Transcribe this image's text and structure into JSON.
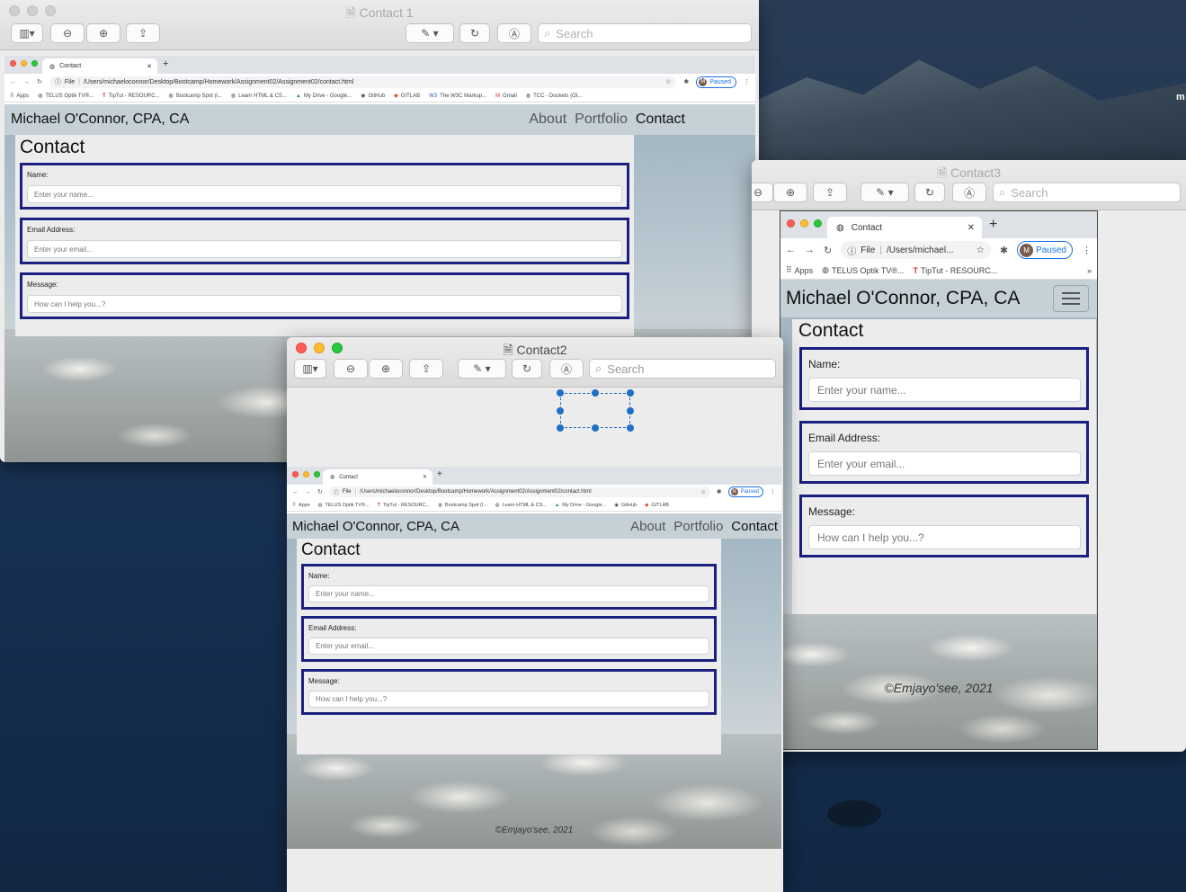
{
  "site": {
    "brand": "Michael O'Connor, CPA, CA",
    "nav": [
      "About",
      "Portfolio",
      "Contact"
    ],
    "heading": "Contact",
    "name_label": "Name:",
    "name_placeholder": "Enter your name...",
    "email_label": "Email Address:",
    "email_placeholder": "Enter your email...",
    "message_label": "Message:",
    "message_placeholder": "How can I help you...?",
    "footer": "©Emjayo'see, 2021"
  },
  "browser": {
    "tab_title": "Contact",
    "new_tab": "+",
    "file_label": "File",
    "url": "/Users/michaeloconnor/Desktop/Bootcamp/Homework/Assignment02/Assignment02/contact.html",
    "url_short": "/Users/michael...",
    "paused": "Paused",
    "avatar": "M",
    "bookmarks": [
      "Apps",
      "TELUS Optik TV®...",
      "TipTut - RESOURC...",
      "Bootcamp Spot (l...",
      "Learn HTML & CS...",
      "My Drive - Google...",
      "GitHub",
      "GITLAB",
      "The W3C Markup...",
      "Gmail",
      "TCC - Dockets (Ol..."
    ]
  },
  "windows": {
    "contact1": {
      "title": "Contact 1"
    },
    "contact2": {
      "title": "Contact2"
    },
    "contact3": {
      "title": "Contact3"
    }
  },
  "preview": {
    "search_placeholder": "Search"
  },
  "icons": [
    "sidebar-icon",
    "zoom-out-icon",
    "zoom-in-icon",
    "share-icon",
    "markup-pen-icon",
    "rotate-icon",
    "annotate-icon",
    "search-icon",
    "star-icon",
    "extensions-icon",
    "more-icon",
    "reload-icon",
    "back-icon",
    "forward-icon",
    "info-icon",
    "document-icon"
  ],
  "colors": {
    "form_border": "#1b1f80",
    "navbar": "#c5d1d6",
    "paused": "#1a73e8",
    "desktop": "#1c3450"
  }
}
